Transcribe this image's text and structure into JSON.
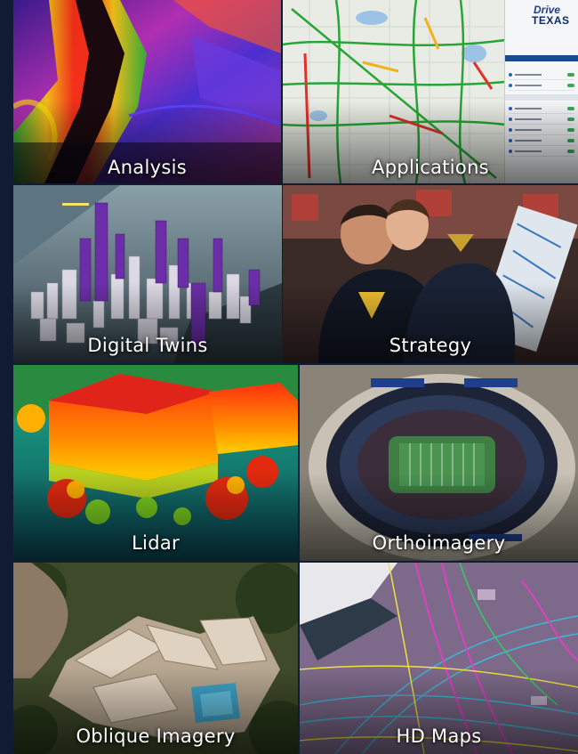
{
  "tiles": [
    {
      "id": "analysis",
      "label": "Analysis"
    },
    {
      "id": "applications",
      "label": "Applications"
    },
    {
      "id": "digital_twins",
      "label": "Digital Twins"
    },
    {
      "id": "strategy",
      "label": "Strategy"
    },
    {
      "id": "lidar",
      "label": "Lidar"
    },
    {
      "id": "orthoimagery",
      "label": "Orthoimagery"
    },
    {
      "id": "oblique_imagery",
      "label": "Oblique Imagery"
    },
    {
      "id": "hd_maps",
      "label": "HD Maps"
    }
  ],
  "applications_panel": {
    "logo_drive": "Drive",
    "logo_texas": "TEXAS"
  },
  "colors": {
    "page_background": "#0f1c33",
    "label_text": "#ffffff"
  }
}
